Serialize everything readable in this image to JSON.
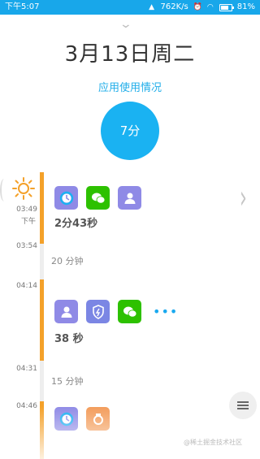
{
  "status_bar": {
    "time": "下午5:07",
    "network_speed": "762K/s",
    "battery_percent": "81%",
    "battery_level": 0.81
  },
  "header": {
    "date": "3月13日周二",
    "usage_title": "应用使用情况",
    "usage_total": "7分"
  },
  "timeline": {
    "entries": [
      {
        "time": "03:49",
        "time_sub": "下午",
        "apps": [
          "clock-icon",
          "wechat-icon",
          "contact-icon"
        ],
        "duration": "2分43秒"
      },
      {
        "time": "03:54",
        "idle": "20 分钟"
      },
      {
        "time": "04:14",
        "apps": [
          "contact-icon",
          "security-icon",
          "wechat-icon"
        ],
        "more": "•••",
        "duration": "38 秒"
      },
      {
        "time": "04:31",
        "idle": "15 分钟"
      },
      {
        "time": "04:46",
        "apps": [
          "clock-icon",
          "camera-icon"
        ]
      }
    ]
  },
  "watermark": "@稀土掘金技术社区"
}
